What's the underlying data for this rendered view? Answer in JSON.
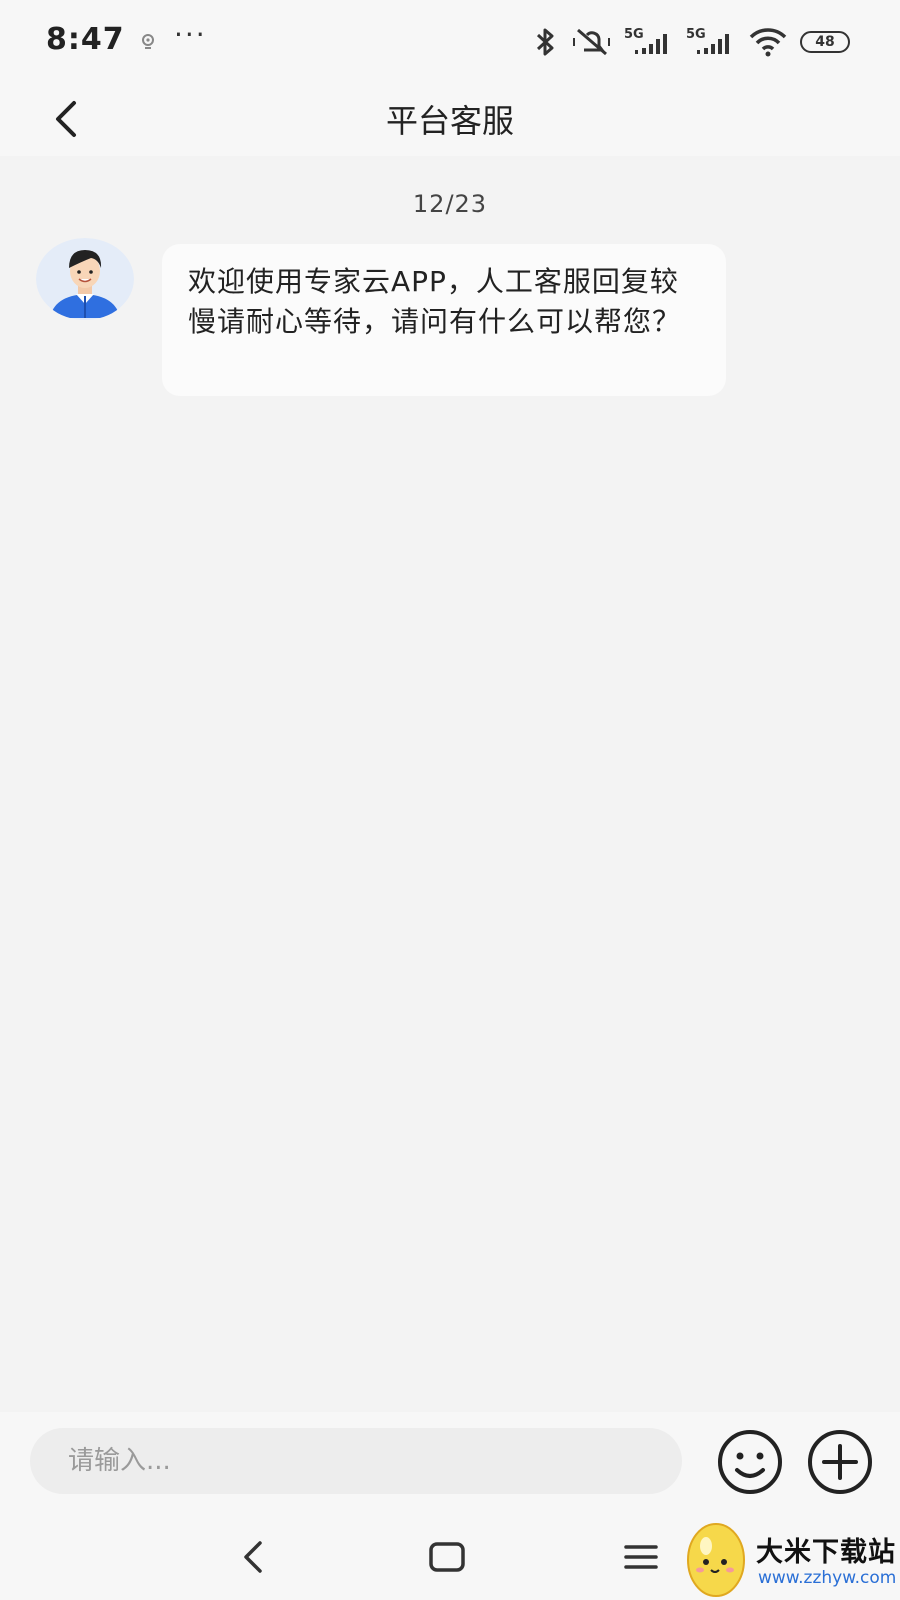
{
  "status_bar": {
    "time": "8:47",
    "dots": "···",
    "battery": "48",
    "signal_label_1": "5G",
    "signal_label_2": "5G"
  },
  "header": {
    "title": "平台客服"
  },
  "chat": {
    "date": "12/23",
    "messages": [
      {
        "sender": "agent",
        "text": "欢迎使用专家云APP，人工客服回复较慢请耐心等待，请问有什么可以帮您？"
      }
    ]
  },
  "composer": {
    "placeholder": "请输入..."
  },
  "watermark": {
    "title": "大米下载站",
    "url": "www.zzhyw.com"
  },
  "colors": {
    "background": "#f3f3f3",
    "bar": "#f7f7f7",
    "bubble": "#fbfbfb",
    "avatar_blue": "#2f6fe0",
    "watermark_url": "#2a6fd6"
  },
  "icons": {
    "back": "chevron-left-icon",
    "emoji": "smiley-icon",
    "plus": "plus-circle-icon",
    "nav_back": "nav-back-icon",
    "nav_home": "nav-home-icon",
    "nav_menu": "nav-menu-icon"
  }
}
